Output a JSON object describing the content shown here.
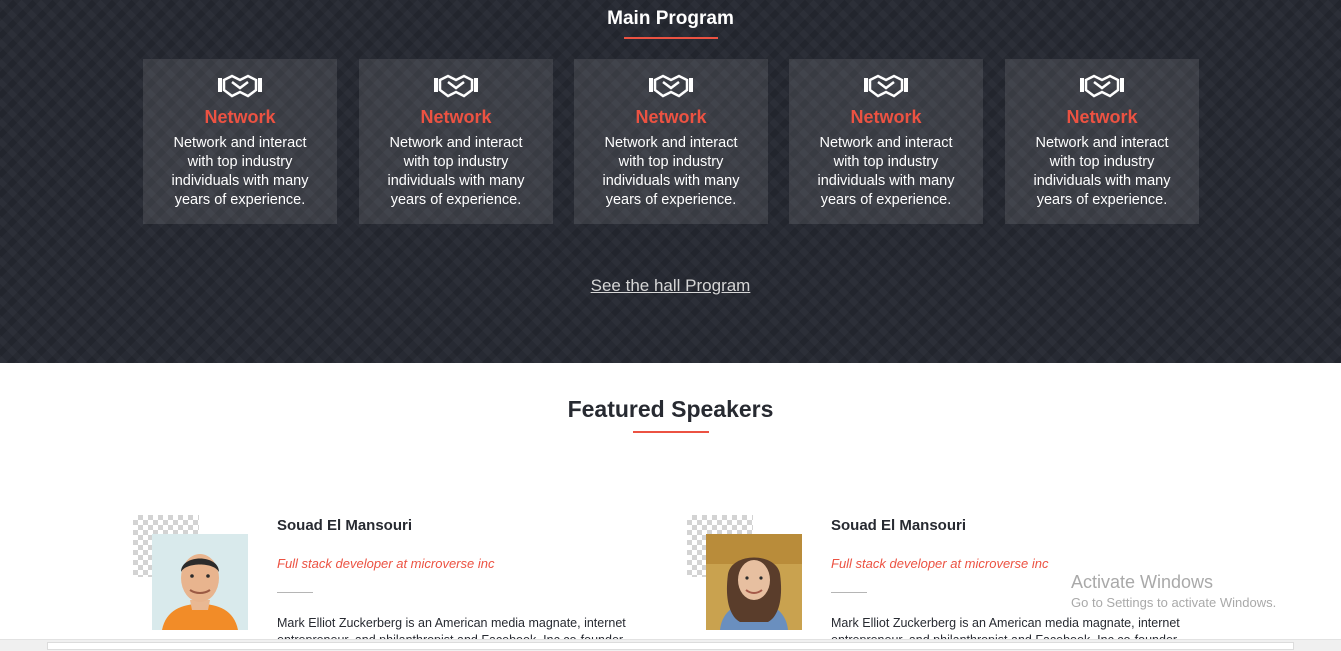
{
  "program": {
    "title": "Main Program",
    "cards": [
      {
        "title": "Network",
        "text": "Network and interact with top industry individuals with many years of experience.",
        "icon": "handshake-icon"
      },
      {
        "title": "Network",
        "text": "Network and interact with top industry individuals with many years of experience.",
        "icon": "handshake-icon"
      },
      {
        "title": "Network",
        "text": "Network and interact with top industry individuals with many years of experience.",
        "icon": "handshake-icon"
      },
      {
        "title": "Network",
        "text": "Network and interact with top industry individuals with many years of experience.",
        "icon": "handshake-icon"
      },
      {
        "title": "Network",
        "text": "Network and interact with top industry individuals with many years of experience.",
        "icon": "handshake-icon"
      }
    ],
    "hall_link": "See the hall Program"
  },
  "speakers": {
    "title": "Featured Speakers",
    "items": [
      {
        "name": "Souad El Mansouri",
        "role": "Full stack developer at microverse inc",
        "bio": "Mark Elliot Zuckerberg is an American media magnate, internet entrepreneur, and philanthropist and Facebook, Inc co-founder."
      },
      {
        "name": "Souad El Mansouri",
        "role": "Full stack developer at microverse inc",
        "bio": "Mark Elliot Zuckerberg is an American media magnate, internet entrepreneur, and philanthropist and Facebook, Inc co-founder."
      }
    ]
  },
  "watermark": {
    "line1": "Activate Windows",
    "line2": "Go to Settings to activate Windows."
  },
  "colors": {
    "accent": "#ec5242",
    "dark_bg": "#272a33",
    "text_dark": "#272a31"
  }
}
